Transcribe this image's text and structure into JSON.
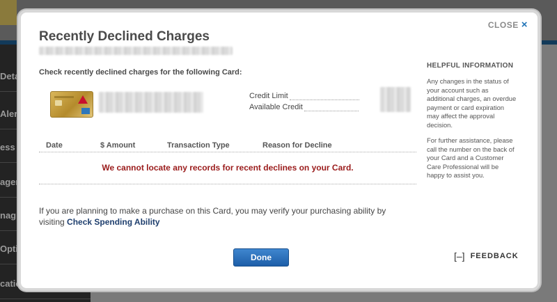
{
  "background": {
    "sidebar_items": [
      "Deta",
      "Alert",
      "ess",
      "ager",
      "nag",
      "Opti",
      "catio"
    ]
  },
  "modal": {
    "close_label": "CLOSE",
    "close_icon": "×",
    "title": "Recently Declined Charges",
    "instruction": "Check recently declined charges for the following Card:",
    "credit_limit_label": "Credit Limit",
    "available_credit_label": "Available Credit",
    "table_headers": [
      "Date",
      "$ Amount",
      "Transaction Type",
      "Reason for Decline"
    ],
    "no_records_message": "We cannot locate any records for recent declines on your Card.",
    "purchase_text": "If you are planning to make a purchase on this Card, you may verify your purchasing ability by visiting",
    "check_spending_link": "Check Spending Ability",
    "done_label": "Done",
    "side_panel": {
      "heading": "HELPFUL INFORMATION",
      "para1": "Any changes in the status of your account such as additional charges, an overdue payment or card expiration may affect the approval decision.",
      "para2": "For further assistance, please call the number on the back of your Card and a Customer Care Professional will be happy to assist you."
    },
    "feedback_icon": "[–]",
    "feedback_label": "FEEDBACK"
  },
  "colors": {
    "accent": "#1f73b7",
    "error_text": "#9a1b1b",
    "done_button": "#2a6fba"
  }
}
